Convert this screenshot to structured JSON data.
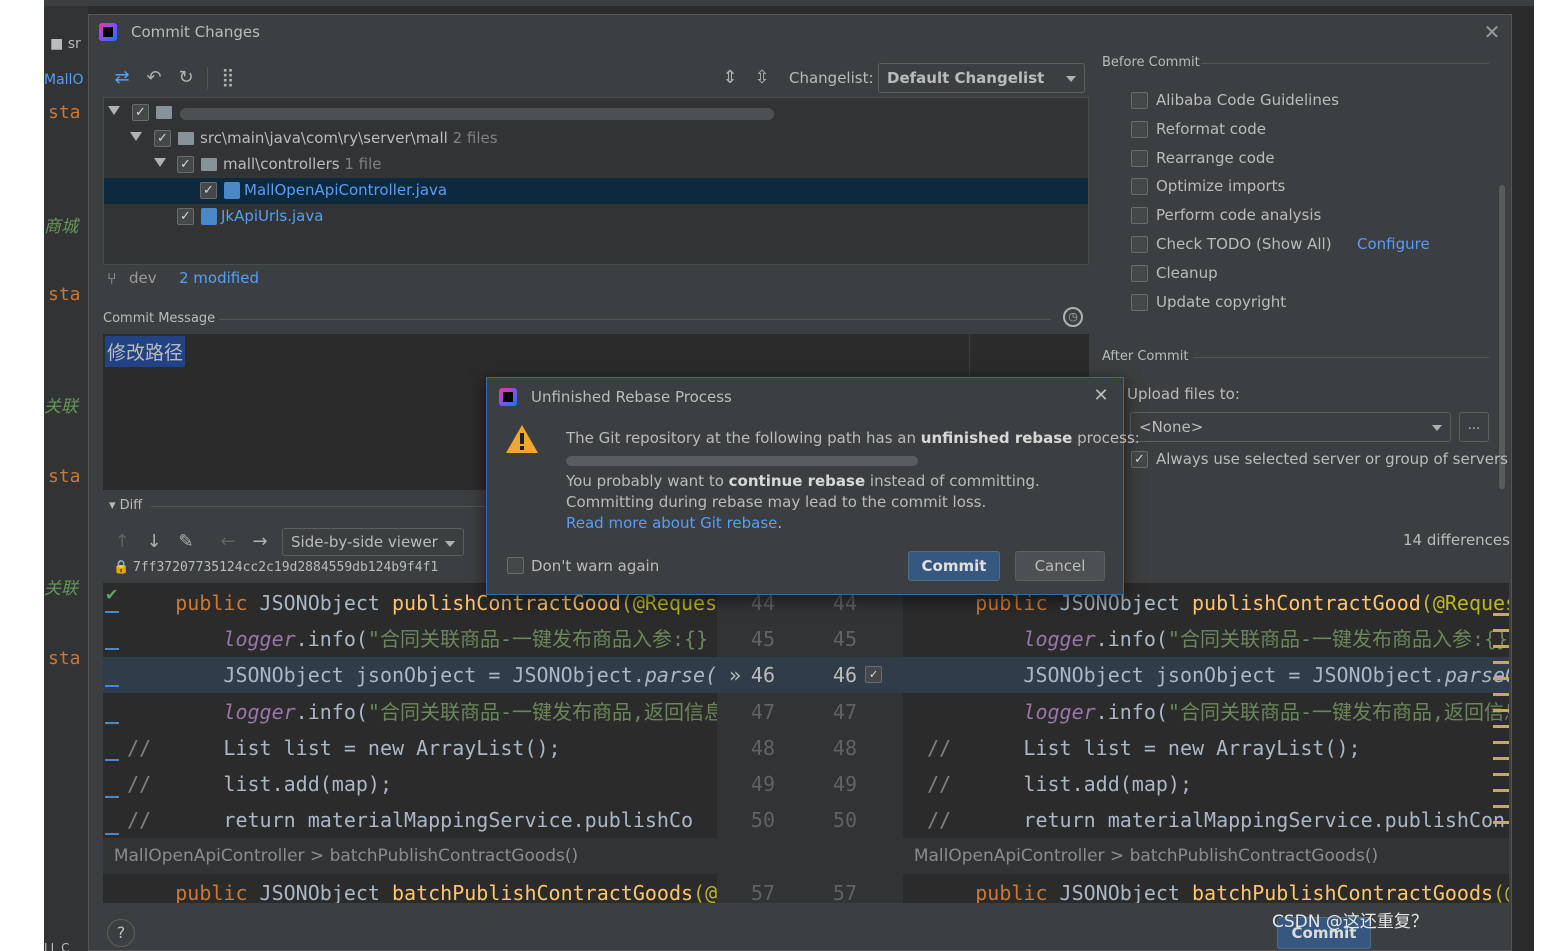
{
  "ide": {
    "tab_label": "sr",
    "mallo_label": "MallO",
    "code_fragment": "sta",
    "cn_fragments": [
      "商城",
      "关联",
      "关联"
    ],
    "bottom_label": "LL C"
  },
  "commit_dialog": {
    "title": "Commit Changes",
    "changelist_label": "Changelist:",
    "changelist_value": "Default Changelist",
    "tree": [
      {
        "label": "src\\main\\java\\com\\ry\\server\\mall",
        "count": "2 files"
      },
      {
        "label": "mall\\controllers",
        "count": "1 file"
      },
      {
        "label": "MallOpenApiController.java",
        "count": ""
      },
      {
        "label": "JkApiUrls.java",
        "count": ""
      }
    ],
    "branch": "dev",
    "modified": "2 modified",
    "commit_message_label": "Commit Message",
    "commit_message": "修改路径",
    "diff_label": "Diff",
    "viewer_mode": "Side-by-side viewer",
    "commit_hash": "7ff37207735124cc2c19d2884559db124b9f4f1",
    "differences": "14 differences",
    "before_commit_label": "Before Commit",
    "before_commit_options": [
      {
        "label": "Alibaba Code Guidelines",
        "checked": false,
        "link": ""
      },
      {
        "label": "Reformat code",
        "checked": false,
        "link": ""
      },
      {
        "label": "Rearrange code",
        "checked": false,
        "link": ""
      },
      {
        "label": "Optimize imports",
        "checked": false,
        "link": ""
      },
      {
        "label": "Perform code analysis",
        "checked": false,
        "link": ""
      },
      {
        "label": "Check TODO (Show All)",
        "checked": false,
        "link": "Configure"
      },
      {
        "label": "Cleanup",
        "checked": false,
        "link": ""
      },
      {
        "label": "Update copyright",
        "checked": false,
        "link": ""
      }
    ],
    "after_commit_label": "After Commit",
    "upload_label": "Upload files to:",
    "upload_value": "<None>",
    "upload_more": "...",
    "always_use_label": "Always use selected server or group of servers",
    "help": "?",
    "commit_button": "Commit",
    "watermark": "CSDN @这还重复？"
  },
  "diff": {
    "left_lines": [
      {
        "indent": "    ",
        "parts": [
          [
            "kw",
            "public "
          ],
          [
            "",
            "JSONObject "
          ],
          [
            "fn",
            "publishContractGood"
          ],
          [
            "ann",
            "(@Reques"
          ]
        ]
      },
      {
        "indent": "        ",
        "parts": [
          [
            "logger",
            "logger"
          ],
          [
            "",
            ".info("
          ],
          [
            "str",
            "\"合同关联商品-一键发布商品入参:{}"
          ]
        ]
      },
      {
        "indent": "        ",
        "parts": [
          [
            "",
            "JSONObject jsonObject = JSONObject."
          ],
          [
            "it",
            "parse("
          ]
        ]
      },
      {
        "indent": "        ",
        "parts": [
          [
            "logger",
            "logger"
          ],
          [
            "",
            ".info("
          ],
          [
            "str",
            "\"合同关联商品-一键发布商品,返回信息"
          ]
        ]
      },
      {
        "indent": "",
        "parts": [
          [
            "cmt",
            "//"
          ],
          [
            "",
            "      List list = new ArrayList();"
          ]
        ]
      },
      {
        "indent": "",
        "parts": [
          [
            "cmt",
            "//"
          ],
          [
            "",
            "      list.add(map);"
          ]
        ]
      },
      {
        "indent": "",
        "parts": [
          [
            "cmt",
            "//"
          ],
          [
            "",
            "      return materialMappingService.publishCo"
          ]
        ]
      },
      {
        "indent": "",
        "parts": [
          [
            "",
            "MallOpenApiController > batchPublishContractGoods()"
          ]
        ]
      },
      {
        "indent": "    ",
        "parts": [
          [
            "kw",
            "public "
          ],
          [
            "",
            "JSONObject "
          ],
          [
            "fn",
            "batchPublishContractGoods"
          ],
          [
            "ann",
            "(@"
          ]
        ]
      }
    ],
    "right_lines": [
      {
        "indent": "    ",
        "parts": [
          [
            "kw",
            "public "
          ],
          [
            "",
            "JSONObject "
          ],
          [
            "fn",
            "publishContractGood"
          ],
          [
            "ann",
            "(@RequestB"
          ]
        ]
      },
      {
        "indent": "        ",
        "parts": [
          [
            "logger",
            "logger"
          ],
          [
            "",
            ".info("
          ],
          [
            "str",
            "\"合同关联商品-一键发布商品入参:{}\""
          ]
        ]
      },
      {
        "indent": "        ",
        "parts": [
          [
            "",
            "JSONObject jsonObject = JSONObject."
          ],
          [
            "it",
            "parseOb"
          ]
        ]
      },
      {
        "indent": "        ",
        "parts": [
          [
            "logger",
            "logger"
          ],
          [
            "",
            ".info("
          ],
          [
            "str",
            "\"合同关联商品-一键发布商品,返回信息:"
          ]
        ]
      },
      {
        "indent": "",
        "parts": [
          [
            "cmt",
            "//"
          ],
          [
            "",
            "      List list = new ArrayList();"
          ]
        ]
      },
      {
        "indent": "",
        "parts": [
          [
            "cmt",
            "//"
          ],
          [
            "",
            "      list.add(map);"
          ]
        ]
      },
      {
        "indent": "",
        "parts": [
          [
            "cmt",
            "//"
          ],
          [
            "",
            "      return materialMappingService.publishCon"
          ]
        ]
      },
      {
        "indent": "",
        "parts": [
          [
            "",
            "MallOpenApiController > batchPublishContractGoods()"
          ]
        ]
      },
      {
        "indent": "    ",
        "parts": [
          [
            "kw",
            "public "
          ],
          [
            "",
            "JSONObject "
          ],
          [
            "fn",
            "batchPublishContractGoods"
          ],
          [
            "ann",
            "(@Re"
          ]
        ]
      }
    ],
    "line_numbers": [
      "44",
      "45",
      "46",
      "47",
      "48",
      "49",
      "50",
      "",
      "57"
    ],
    "fold_line_index": 7,
    "highlight_line_index": 2,
    "apply_arrow": "»"
  },
  "rebase_dialog": {
    "title": "Unfinished Rebase Process",
    "line1_pre": "The Git repository at the following path has an ",
    "line1_bold": "unfinished rebase",
    "line1_post": " process:",
    "line2_pre": "You probably want to ",
    "line2_bold": "continue rebase",
    "line2_post": " instead of committing.",
    "line3": "Committing during rebase may lead to the commit loss.",
    "link": "Read more about Git rebase",
    "link_suffix": ".",
    "dont_warn": "Don't warn again",
    "commit": "Commit",
    "cancel": "Cancel"
  },
  "colors": {
    "accent": "#365880",
    "link": "#589df6",
    "dialog_bg": "#3c3f41",
    "editor_bg": "#2b2b2b"
  }
}
